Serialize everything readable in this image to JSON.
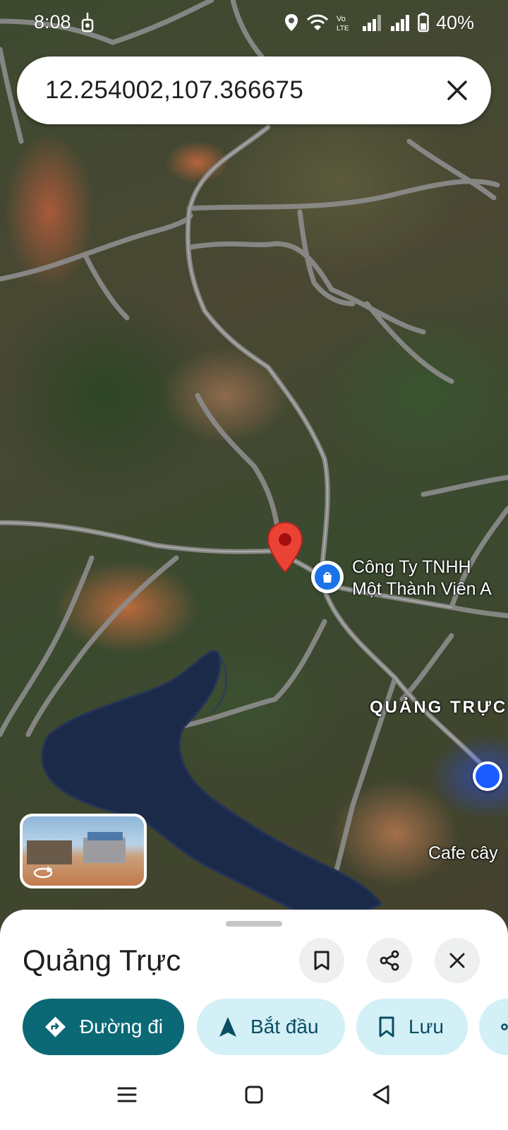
{
  "status_bar": {
    "time": "8:08",
    "battery_percent": "40%",
    "icons": [
      "location-icon",
      "wifi-icon",
      "volte-icon",
      "signal-icon",
      "signal-icon",
      "battery-icon"
    ]
  },
  "search": {
    "query": "12.254002,107.366675"
  },
  "map": {
    "poi_label_line1": "Công Ty TNHH",
    "poi_label_line2": "Một Thành Viên A",
    "area_label": "QUẢNG TRỰC",
    "cafe_label": "Cafe cây"
  },
  "place": {
    "title": "Quảng Trực"
  },
  "actions": {
    "directions": "Đường đi",
    "start": "Bắt đầu",
    "save": "Lưu"
  },
  "colors": {
    "primary_chip": "#0b6875",
    "secondary_chip": "#d3f0f7",
    "pin": "#ea4335",
    "poi": "#1a73e8"
  }
}
